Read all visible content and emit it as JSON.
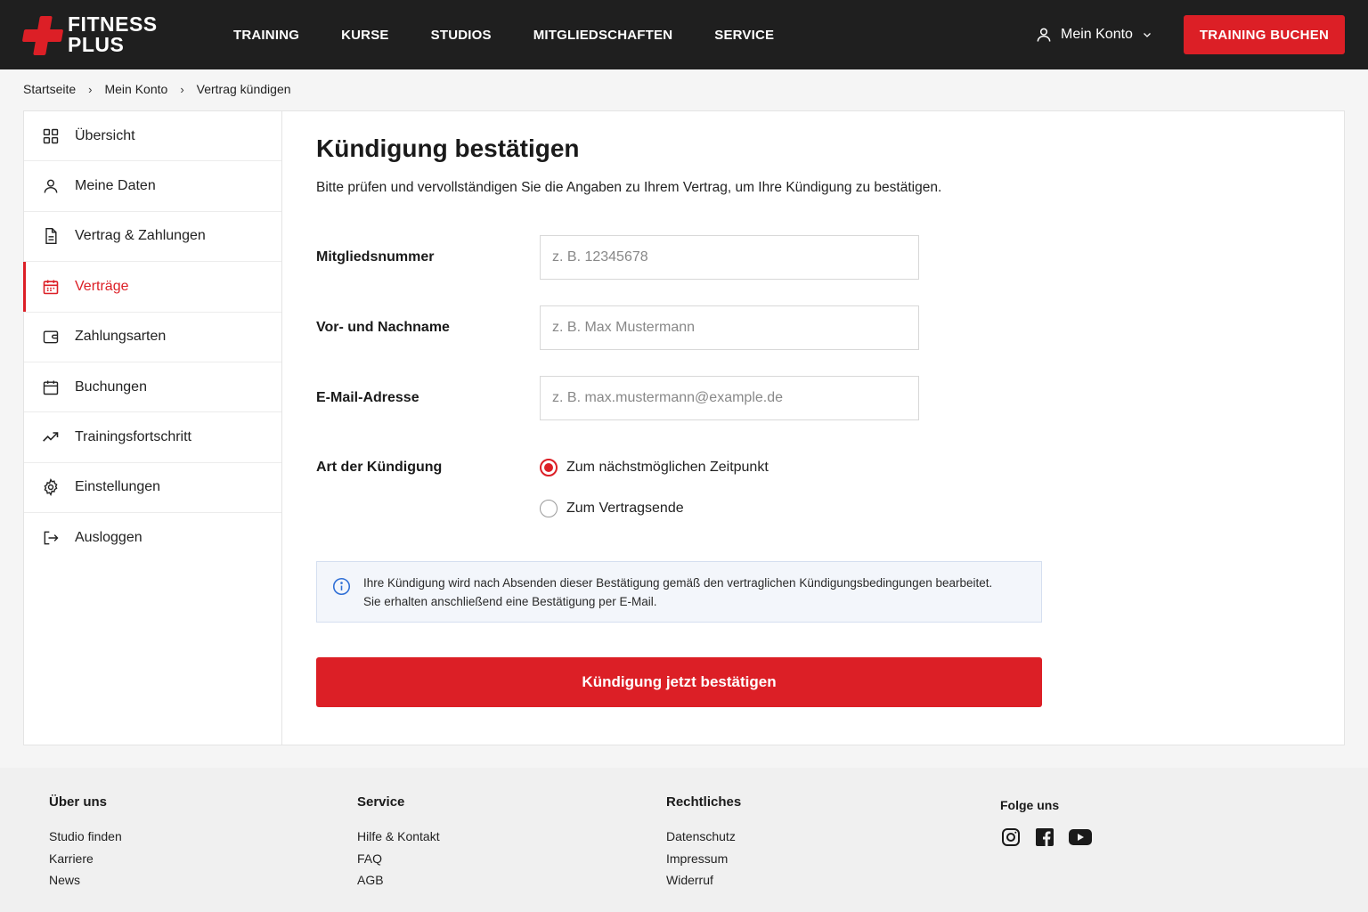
{
  "header": {
    "logo_line1": "FITNESS",
    "logo_line2": "PLUS",
    "nav": [
      "TRAINING",
      "KURSE",
      "STUDIOS",
      "MITGLIEDSCHAFTEN",
      "SERVICE"
    ],
    "account_label": "Mein Konto",
    "book_button": "TRAINING BUCHEN"
  },
  "breadcrumb": [
    "Startseite",
    "Mein Konto",
    "Vertrag kündigen"
  ],
  "sidebar": {
    "items": [
      {
        "label": "Übersicht",
        "icon": "grid-icon"
      },
      {
        "label": "Meine Daten",
        "icon": "user-icon"
      },
      {
        "label": "Vertrag & Zahlungen",
        "icon": "document-icon"
      },
      {
        "label": "Verträge",
        "icon": "calendar-icon",
        "active": true
      },
      {
        "label": "Zahlungsarten",
        "icon": "wallet-icon"
      },
      {
        "label": "Buchungen",
        "icon": "calendar-icon"
      },
      {
        "label": "Trainingsfortschritt",
        "icon": "trend-icon"
      },
      {
        "label": "Einstellungen",
        "icon": "gear-icon"
      },
      {
        "label": "Ausloggen",
        "icon": "logout-icon"
      }
    ]
  },
  "main": {
    "title": "Kündigung bestätigen",
    "intro": "Bitte prüfen und vervollständigen Sie die Angaben zu Ihrem Vertrag, um Ihre Kündigung zu bestätigen.",
    "fields": {
      "member_number": {
        "label": "Mitgliedsnummer",
        "placeholder": "z. B. 12345678",
        "value": ""
      },
      "name": {
        "label": "Vor- und Nachname",
        "placeholder": "z. B. Max Mustermann",
        "value": ""
      },
      "email": {
        "label": "E-Mail-Adresse",
        "placeholder": "z. B. max.mustermann@example.de",
        "value": ""
      }
    },
    "cancel_type": {
      "label": "Art der Kündigung",
      "options": [
        "Zum nächstmöglichen Zeitpunkt",
        "Zum Vertragsende"
      ],
      "selected": "Zum nächstmöglichen Zeitpunkt"
    },
    "info_line1": "Ihre Kündigung wird nach Absenden dieser Bestätigung gemäß den vertraglichen Kündigungsbedingungen bearbeitet.",
    "info_line2": "Sie erhalten anschließend eine Bestätigung per E-Mail.",
    "submit_label": "Kündigung jetzt bestätigen"
  },
  "footer": {
    "columns": [
      {
        "title": "Über uns",
        "links": [
          "Studio finden",
          "Karriere",
          "News"
        ]
      },
      {
        "title": "Service",
        "links": [
          "Hilfe & Kontakt",
          "FAQ",
          "AGB"
        ]
      },
      {
        "title": "Rechtliches",
        "links": [
          "Datenschutz",
          "Impressum",
          "Widerruf"
        ]
      }
    ],
    "social_title": "Folge uns",
    "social": [
      "instagram-icon",
      "facebook-icon",
      "youtube-icon"
    ]
  },
  "colors": {
    "brand_red": "#dc1f26",
    "header_bg": "#1f1f1f",
    "info_bg": "#f3f6fb",
    "info_icon": "#2f6fd6"
  }
}
